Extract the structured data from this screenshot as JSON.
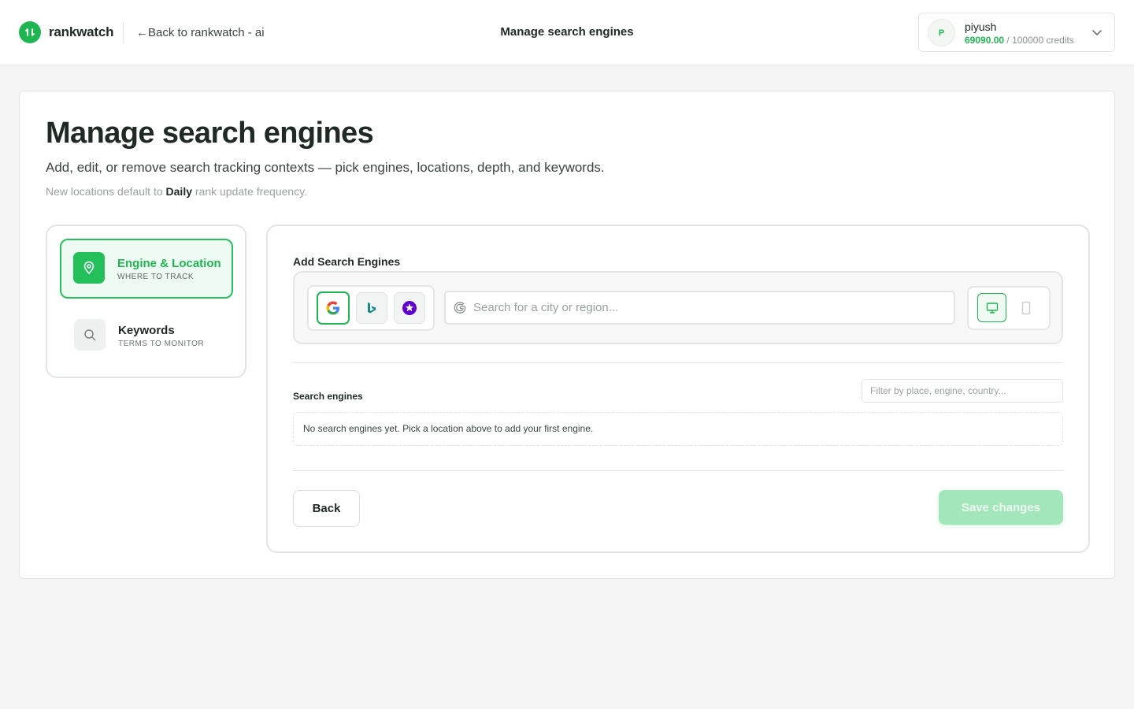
{
  "app": {
    "brand": "rankwatch",
    "back_link": "←Back to rankwatch - ai",
    "title": "Manage search engines"
  },
  "user": {
    "initial": "P",
    "name": "piyush",
    "credits_current": "69090.00",
    "credits_total": "/ 100000 credits"
  },
  "page": {
    "title": "Manage search engines",
    "subtitle": "Add, edit, or remove search tracking contexts — pick engines, locations, depth, and keywords.",
    "note_prefix": "New locations default to ",
    "note_bold": "Daily",
    "note_suffix": " rank update frequency."
  },
  "steps": [
    {
      "title": "Engine & Location",
      "subtitle": "WHERE TO TRACK",
      "icon": "map-pin-icon",
      "active": true
    },
    {
      "title": "Keywords",
      "subtitle": "TERMS TO MONITOR",
      "icon": "search-icon",
      "active": false
    }
  ],
  "add_engines": {
    "label": "Add Search Engines",
    "engines": [
      {
        "name": "google-icon",
        "selected": true
      },
      {
        "name": "bing-icon",
        "selected": false
      },
      {
        "name": "yahoo-icon",
        "selected": false
      }
    ],
    "location_placeholder": "Search for a city or region...",
    "devices": [
      {
        "name": "desktop-icon",
        "selected": true
      },
      {
        "name": "mobile-icon",
        "selected": false
      }
    ]
  },
  "list": {
    "label": "Search engines",
    "filter_placeholder": "Filter by place, engine, country...",
    "empty_text": "No search engines yet. Pick a location above to add your first engine."
  },
  "actions": {
    "back_label": "Back",
    "save_label": "Save changes"
  },
  "colors": {
    "accent": "#1fb552",
    "accent_light": "#eefbf2",
    "save_disabled": "#a3e6bb"
  }
}
